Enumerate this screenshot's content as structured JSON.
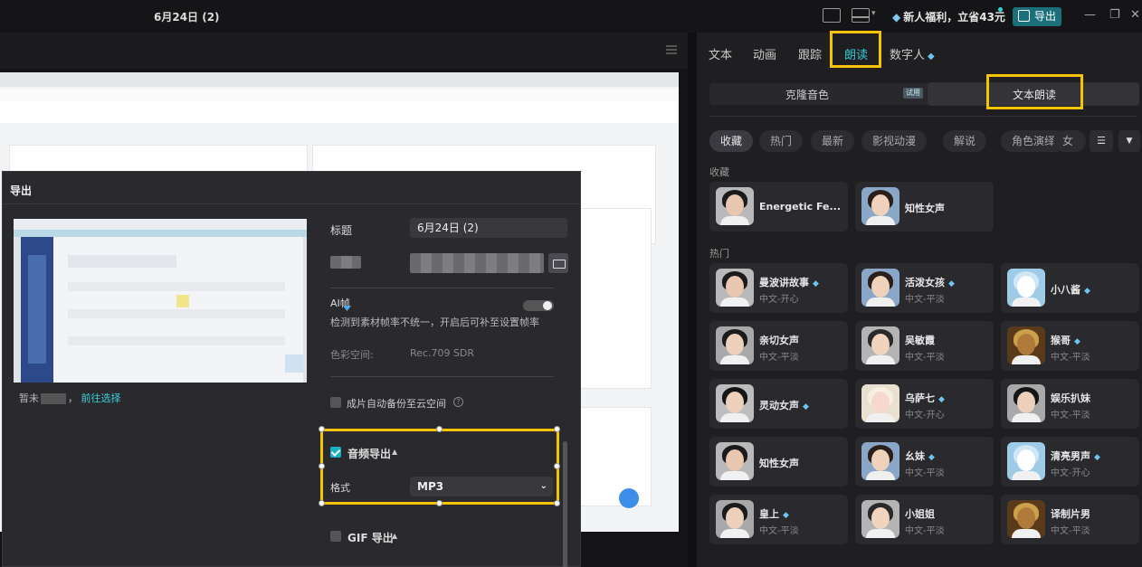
{
  "titlebar": {
    "doc_title": "6月24日 (2)",
    "promo": "新人福利，立省43元",
    "export_label": "导出"
  },
  "dialog": {
    "title": "导出",
    "title_label": "标题",
    "title_value": "6月24日 (2)",
    "ai_text": "AI帧",
    "ai_desc": "检测到素材帧率不统一，开启后可补至设置帧率",
    "color_space_label": "色彩空间:",
    "color_space_value": "Rec.709 SDR",
    "backup_label": "成片自动备份至云空间",
    "hint_prefix": "暂未",
    "hint_link": "前往选择",
    "audio_export_label": "音频导出",
    "format_label": "格式",
    "format_value": "MP3",
    "gif_label": "GIF 导出"
  },
  "right_panel": {
    "tabs": [
      "文本",
      "动画",
      "跟踪",
      "朗读",
      "数字人"
    ],
    "active_tab": "朗读",
    "segments": [
      "克隆音色",
      "文本朗读"
    ],
    "trial_badge": "试用",
    "chips": [
      "收藏",
      "热门",
      "最新",
      "影视动漫",
      "解说",
      "角色演绎",
      "女声"
    ],
    "favorites_label": "收藏",
    "hot_label": "热门",
    "favorites": [
      {
        "name": "Energetic Fe...",
        "desc": ""
      },
      {
        "name": "知性女声",
        "desc": ""
      }
    ],
    "hot": [
      {
        "name": "曼波讲故事",
        "desc": "中文-开心",
        "vip": true
      },
      {
        "name": "活泼女孩",
        "desc": "中文-平淡",
        "vip": true
      },
      {
        "name": "小八酱",
        "desc": "",
        "vip": true
      },
      {
        "name": "亲切女声",
        "desc": "中文-平淡",
        "vip": false
      },
      {
        "name": "吴敏霞",
        "desc": "中文-平淡",
        "vip": false
      },
      {
        "name": "猴哥",
        "desc": "中文-平淡",
        "vip": true
      },
      {
        "name": "灵动女声",
        "desc": "",
        "vip": true
      },
      {
        "name": "乌萨七",
        "desc": "中文-开心",
        "vip": true
      },
      {
        "name": "娱乐扒妹",
        "desc": "中文-平淡",
        "vip": false
      },
      {
        "name": "知性女声",
        "desc": "",
        "vip": false
      },
      {
        "name": "幺妹",
        "desc": "中文-平淡",
        "vip": true
      },
      {
        "name": "清亮男声",
        "desc": "中文-开心",
        "vip": true
      },
      {
        "name": "皇上",
        "desc": "中文-平淡",
        "vip": true
      },
      {
        "name": "小姐姐",
        "desc": "中文-平淡",
        "vip": false
      },
      {
        "name": "译制片男",
        "desc": "中文-平淡",
        "vip": false
      }
    ]
  },
  "colors": {
    "accent": "#35c8d3",
    "highlight": "#f5c400",
    "export_button": "#1a6f7a"
  },
  "icons": {
    "gem": "diamond-icon",
    "folder": "folder-icon",
    "filter": "filter-icon"
  }
}
